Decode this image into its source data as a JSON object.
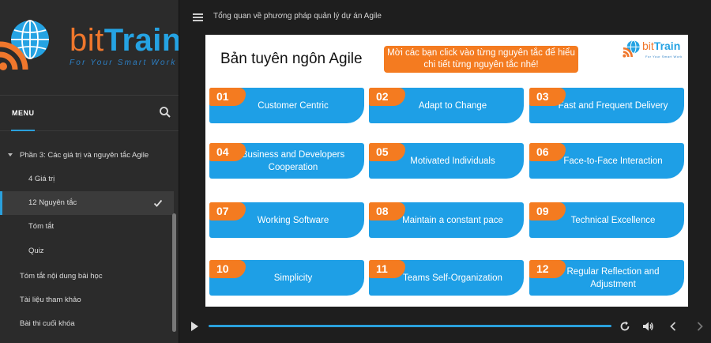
{
  "brand": {
    "logo_bit": "bit",
    "logo_train": "Train",
    "tagline": "For Your Smart Work",
    "brand_orange": "#f0772c",
    "brand_blue": "#25a3e3"
  },
  "sidebar": {
    "menu_label": "MENU",
    "section": "Phần 3: Các giá trị và nguyên tắc Agile",
    "items": [
      {
        "label": "4 Giá trị",
        "active": false
      },
      {
        "label": "12 Nguyên tắc",
        "active": true,
        "completed": true
      },
      {
        "label": "Tóm tắt",
        "active": false
      },
      {
        "label": "Quiz",
        "active": false
      }
    ],
    "top_items": [
      {
        "label": "Tóm tắt nội dung bài học"
      },
      {
        "label": "Tài liệu tham khảo"
      },
      {
        "label": "Bài thi cuối khóa"
      }
    ],
    "icons": {
      "search": "search-icon",
      "check": "check-icon",
      "caret": "caret-down-icon"
    }
  },
  "header": {
    "title": "Tổng quan về phương pháp quản lý dự án Agile",
    "menu_icon": "hamburger-icon"
  },
  "slide": {
    "title": "Bản tuyên ngôn Agile",
    "callout": "Mời các bạn click vào từng nguyên tắc để hiểu chi tiết từng nguyên tắc nhé!",
    "accent_orange": "#f47b20",
    "card_blue": "#1e9fe6",
    "principles": [
      {
        "num": "01",
        "label": "Customer Centric"
      },
      {
        "num": "02",
        "label": "Adapt to Change"
      },
      {
        "num": "03",
        "label": "Fast and Frequent Delivery"
      },
      {
        "num": "04",
        "label": "Business and Developers Cooperation"
      },
      {
        "num": "05",
        "label": "Motivated Individuals"
      },
      {
        "num": "06",
        "label": "Face-to-Face Interaction"
      },
      {
        "num": "07",
        "label": "Working Software"
      },
      {
        "num": "08",
        "label": "Maintain a constant pace"
      },
      {
        "num": "09",
        "label": "Technical Excellence"
      },
      {
        "num": "10",
        "label": "Simplicity"
      },
      {
        "num": "11",
        "label": "Teams Self-Organization"
      },
      {
        "num": "12",
        "label": "Regular Reflection and Adjustment"
      }
    ]
  },
  "player": {
    "icons": [
      "play-icon",
      "replay-icon",
      "volume-icon",
      "prev-icon",
      "next-icon"
    ],
    "accent": "#2aa0dc"
  }
}
